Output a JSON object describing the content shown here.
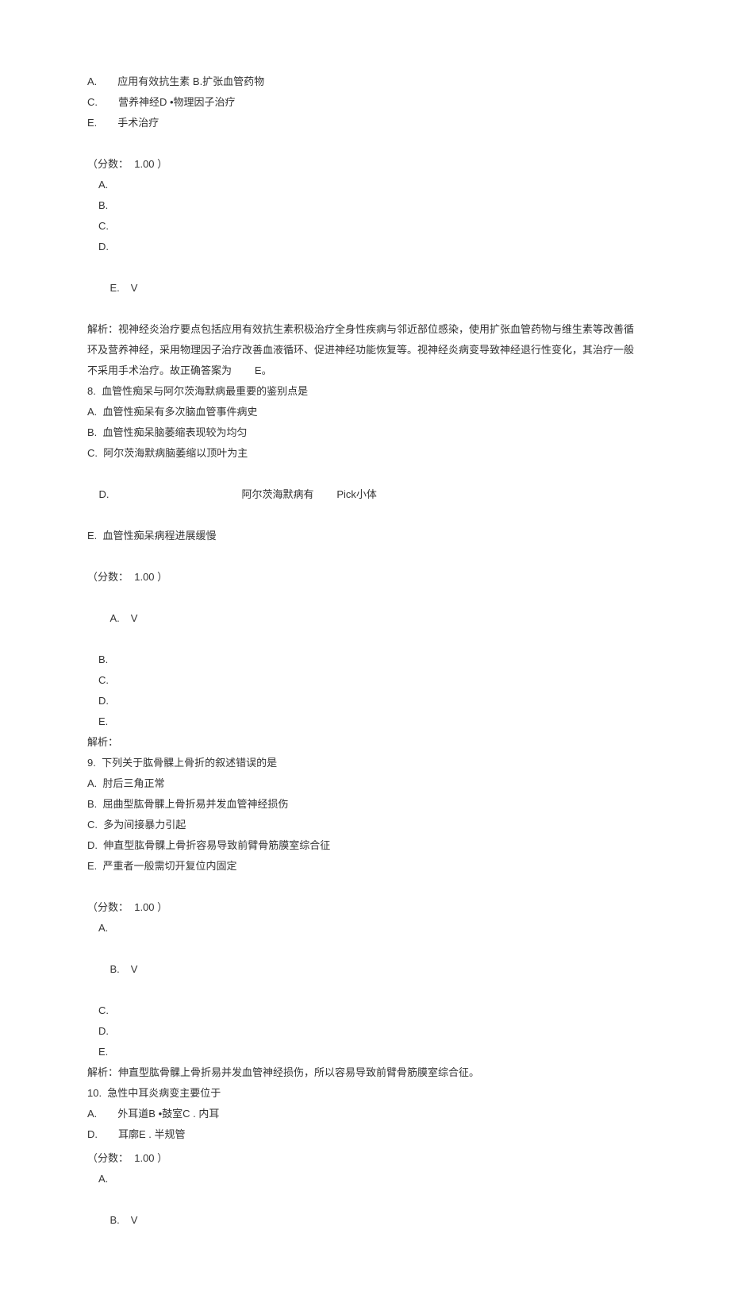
{
  "q7": {
    "opt_a": "A.　　应用有效抗生素 B.扩张血管药物",
    "opt_c": "C.　　营养神经D •物理因子治疗",
    "opt_e": "E.　　手术治疗",
    "score": "（分数：  1.00 ）",
    "ans_a": "A.",
    "ans_b": "B.",
    "ans_c": "C.",
    "ans_d": "D.",
    "ans_e": "E.",
    "check": "V",
    "explain": "解析：视神经炎治疗要点包括应用有效抗生素积极治疗全身性疾病与邻近部位感染，使用扩张血管药物与维生素等改善循环及营养神经，采用物理因子治疗改善血液循环、促进神经功能恢复等。视神经炎病变导致神经退行性变化，其治疗一般不采用手术治疗。故正确答案为        E。"
  },
  "q8": {
    "stem": "8.  血管性痴呆与阿尔茨海默病最重要的鉴别点是",
    "opt_a": "A.  血管性痴呆有多次脑血管事件病史",
    "opt_b": "B.  血管性痴呆脑萎缩表现较为均匀",
    "opt_c": "C.  阿尔茨海默病脑萎缩以顶叶为主",
    "opt_d_label": "D.",
    "opt_d_text": "阿尔茨海默病有        Pick小体",
    "opt_e": "E.  血管性痴呆病程进展缓慢",
    "score": "（分数：  1.00 ）",
    "ans_a": "A.",
    "ans_b": "B.",
    "ans_c": "C.",
    "ans_d": "D.",
    "ans_e": "E.",
    "check": "V",
    "explain": "解析："
  },
  "q9": {
    "stem": "9.  下列关于肱骨髁上骨折的叙述错误的是",
    "opt_a": "A.  肘后三角正常",
    "opt_b": "B.  屈曲型肱骨髁上骨折易并发血管神经损伤",
    "opt_c": "C.  多为间接暴力引起",
    "opt_d": "D.  伸直型肱骨髁上骨折容易导致前臂骨筋膜室综合征",
    "opt_e": "E.  严重者一般需切开复位内固定",
    "score": "（分数：  1.00 ）",
    "ans_a": "A.",
    "ans_b": "B.",
    "ans_c": "C.",
    "ans_d": "D.",
    "ans_e": "E.",
    "check": "V",
    "explain": "解析：伸直型肱骨髁上骨折易并发血管神经损伤，所以容易导致前臂骨筋膜室综合征。"
  },
  "q10": {
    "stem": "10.  急性中耳炎病变主要位于",
    "opt_a": "A.　　外耳道B •鼓室C . 内耳",
    "opt_d": "D.　　耳廓E . 半规管",
    "score": "（分数：  1.00 ）",
    "ans_a": "A.",
    "ans_b": "B.",
    "check": "V"
  }
}
